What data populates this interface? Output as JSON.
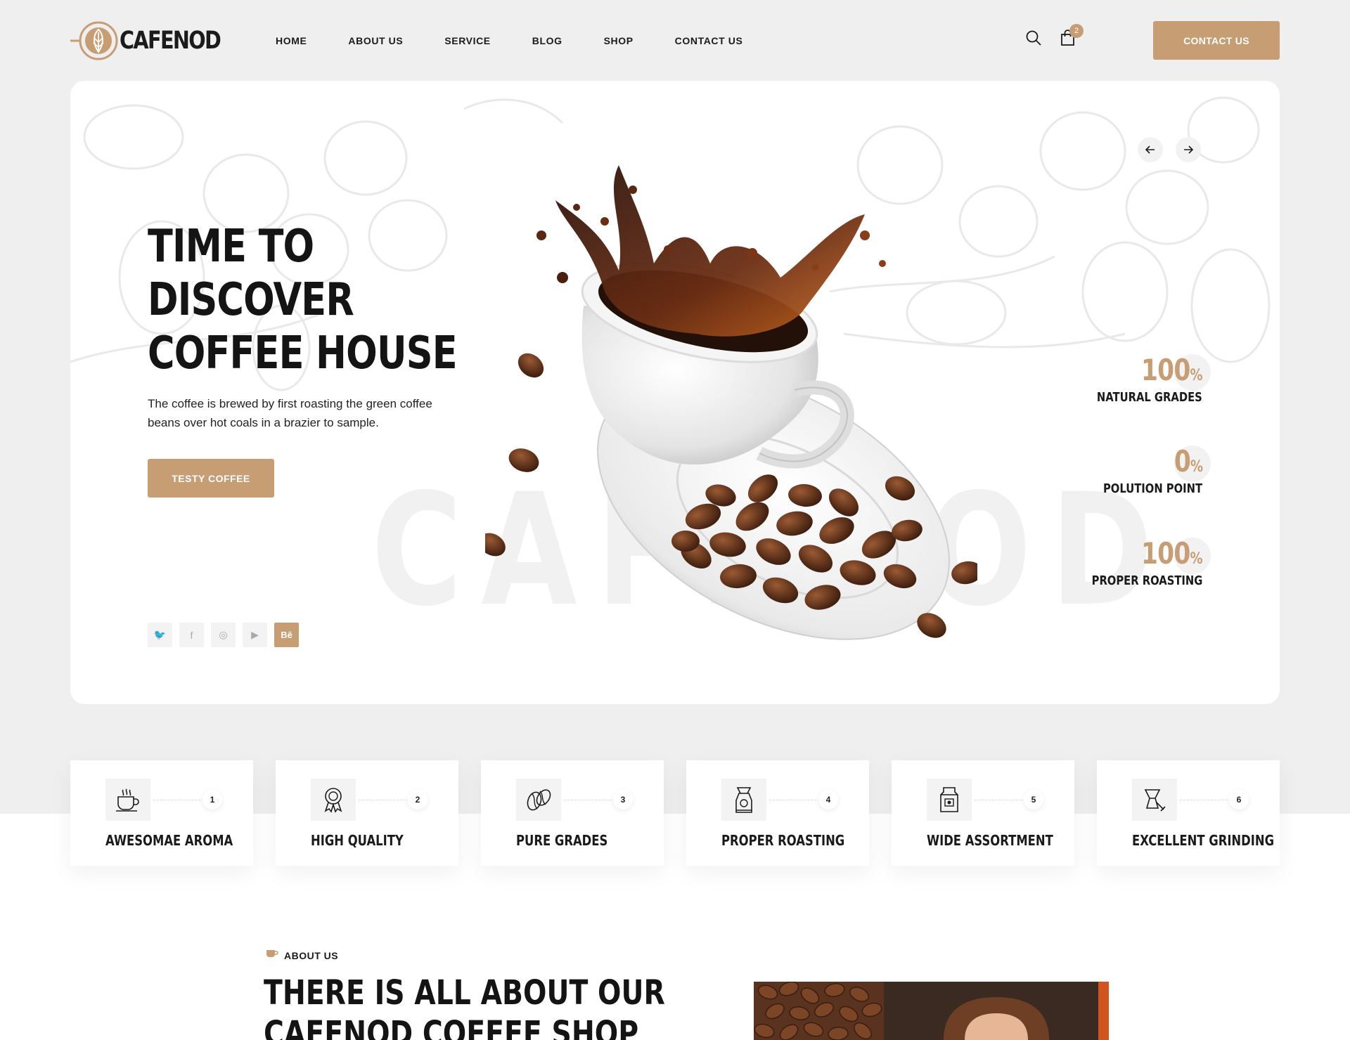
{
  "brand": {
    "name": "CAFENOD",
    "accent_color": "#c79d74",
    "dark_color": "#1b1b1b"
  },
  "nav": {
    "items": [
      {
        "label": "HOME"
      },
      {
        "label": "ABOUT US"
      },
      {
        "label": "SERVICE"
      },
      {
        "label": "BLOG"
      },
      {
        "label": "SHOP"
      },
      {
        "label": "CONTACT US"
      }
    ]
  },
  "header": {
    "cart_count": "2",
    "cta_label": "CONTACT US",
    "icons": [
      "search-icon",
      "shopping-bag-icon"
    ]
  },
  "hero": {
    "title_lines": [
      "TIME TO",
      "DISCOVER",
      "COFFEE HOUSE"
    ],
    "description": "The coffee is brewed by first roasting the green coffee beans over hot coals in a brazier to sample.",
    "button_label": "TESTY COFFEE",
    "watermark": "CAFENOD",
    "socials": [
      {
        "name": "twitter-icon",
        "glyph": "🐦"
      },
      {
        "name": "facebook-icon",
        "glyph": "f"
      },
      {
        "name": "instagram-icon",
        "glyph": "◎"
      },
      {
        "name": "youtube-icon",
        "glyph": "▶"
      },
      {
        "name": "behance-icon",
        "glyph": "Bē"
      }
    ],
    "stats": [
      {
        "value": "100",
        "unit": "%",
        "label": "NATURAL GRADES"
      },
      {
        "value": "0",
        "unit": "%",
        "label": "POLUTION POINT"
      },
      {
        "value": "100",
        "unit": "%",
        "label": "PROPER ROASTING"
      }
    ]
  },
  "features": [
    {
      "num": "1",
      "title": "AWESOMAE AROMA",
      "icon": "coffee-cup-icon"
    },
    {
      "num": "2",
      "title": "HIGH QUALITY",
      "icon": "award-badge-icon"
    },
    {
      "num": "3",
      "title": "PURE GRADES",
      "icon": "coffee-beans-icon"
    },
    {
      "num": "4",
      "title": "PROPER ROASTING",
      "icon": "roaster-icon"
    },
    {
      "num": "5",
      "title": "WIDE ASSORTMENT",
      "icon": "coffee-pack-icon"
    },
    {
      "num": "6",
      "title": "EXCELLENT GRINDING",
      "icon": "grinder-icon"
    }
  ],
  "about": {
    "eyebrow": "ABOUT US",
    "title_lines": [
      "THERE IS ALL ABOUT OUR",
      "CAFENOD COFFEE SHOP"
    ]
  }
}
